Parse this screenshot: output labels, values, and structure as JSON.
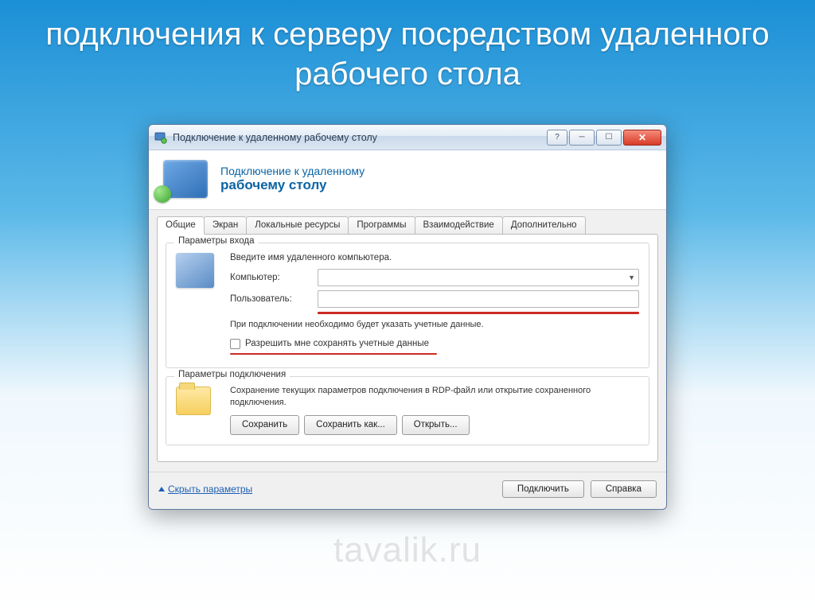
{
  "slide": {
    "title": "подключения к серверу посредством удаленного рабочего стола"
  },
  "window": {
    "title": "Подключение к удаленному рабочему столу",
    "header_line1": "Подключение к удаленному",
    "header_line2": "рабочему столу"
  },
  "tabs": [
    {
      "label": "Общие",
      "active": true
    },
    {
      "label": "Экран",
      "active": false
    },
    {
      "label": "Локальные ресурсы",
      "active": false
    },
    {
      "label": "Программы",
      "active": false
    },
    {
      "label": "Взаимодействие",
      "active": false
    },
    {
      "label": "Дополнительно",
      "active": false
    }
  ],
  "login": {
    "legend": "Параметры входа",
    "instruction": "Введите имя удаленного компьютера.",
    "computer_label": "Компьютер:",
    "computer_value": "",
    "user_label": "Пользователь:",
    "user_value": "",
    "note": "При подключении необходимо будет указать учетные данные.",
    "save_creds_label": "Разрешить мне сохранять учетные данные"
  },
  "conn": {
    "legend": "Параметры подключения",
    "desc": "Сохранение текущих параметров подключения в RDP-файл или открытие сохраненного подключения.",
    "save": "Сохранить",
    "save_as": "Сохранить как...",
    "open": "Открыть..."
  },
  "footer": {
    "hide_params": "Скрыть параметры",
    "connect": "Подключить",
    "help": "Справка"
  },
  "watermark": "tavalik.ru"
}
